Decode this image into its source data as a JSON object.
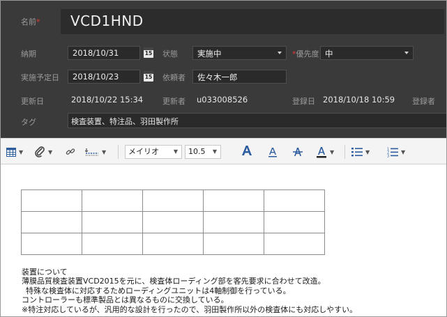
{
  "form": {
    "name_label": "名前",
    "required_mark": "*",
    "name_value": "VCD1HND",
    "due_label": "納期",
    "due_value": "2018/10/31",
    "calendar_badge": "15",
    "status_label": "状態",
    "status_value": "実施中",
    "priority_label": "優先度",
    "priority_value": "中",
    "planned_label": "実施予定日",
    "planned_value": "2018/10/23",
    "requester_label": "依頼者",
    "requester_value": "佐々木一郎",
    "updated_label": "更新日",
    "updated_value": "2018/10/22 15:34",
    "updater_label": "更新者",
    "updater_value": "u033008526",
    "registered_label": "登録日",
    "registered_value": "2018/10/18 10:59",
    "registrant_label": "登録者",
    "tag_label": "タグ",
    "tag_value": "検査装置、特注品、羽田製作所"
  },
  "toolbar": {
    "font_name": "メイリオ",
    "font_size": "10.5",
    "icons": [
      "table-icon",
      "attachment-icon",
      "link-icon",
      "horizontal-rule-icon",
      "bold-font-size-icon",
      "underline-icon",
      "strikethrough-icon",
      "font-color-icon",
      "bullet-list-icon",
      "numbered-list-icon"
    ]
  },
  "editor": {
    "table": {
      "rows": 3,
      "cols": 5
    },
    "lines": [
      "装置について",
      "薄膜品質検査装置VCD2015を元に、検査体ローディング部を客先要求に合わせて改造。",
      "特殊な検査体に対応するためローディングユニットは4軸制御を行っている。",
      "コントローラーも標準製品とは異なるものに交換している。",
      "※特注対応しているが、汎用的な設計を行ったので、羽田製作所以外の検査体にも対応しやすい。"
    ]
  },
  "colors": {
    "form_bg": "#3a3a3a",
    "field_bg": "#2a2a2a",
    "required": "#e23a3a",
    "toolbar_accent": "#2d5d9e"
  }
}
